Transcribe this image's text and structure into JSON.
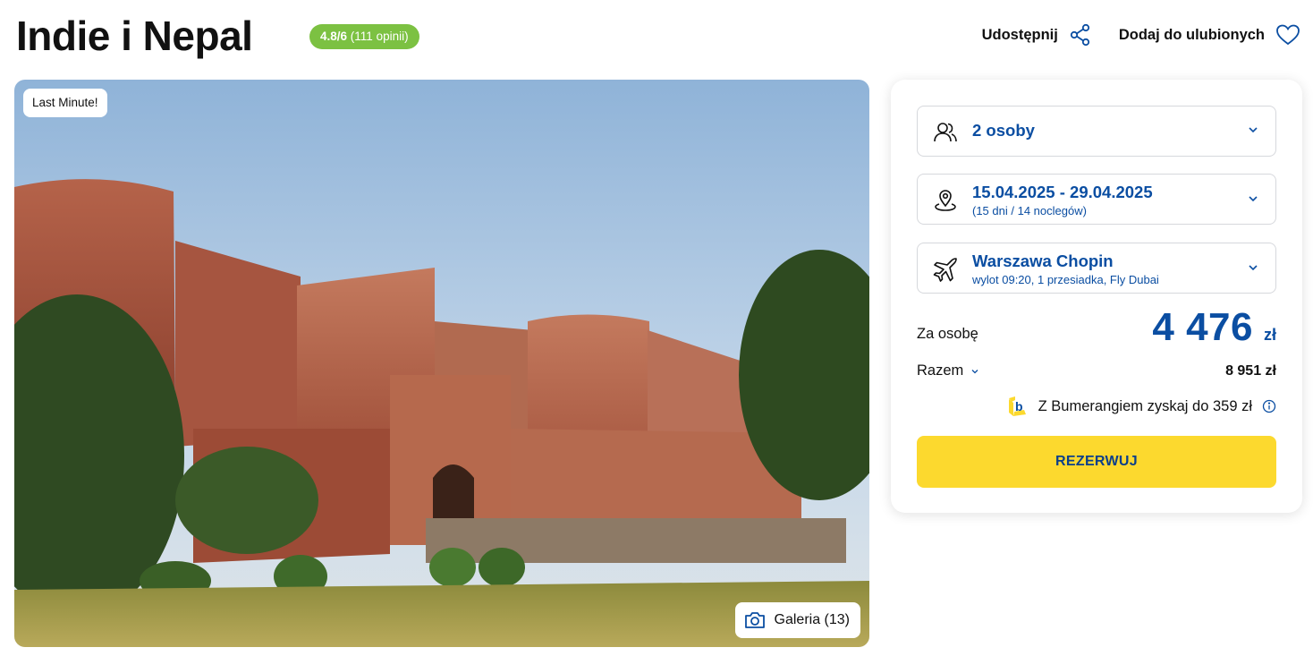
{
  "header": {
    "title": "Indie i Nepal",
    "rating_score": "4.8/6",
    "rating_count": "(111 opinii)",
    "share_label": "Udostępnij",
    "favorite_label": "Dodaj do ulubionych"
  },
  "hero": {
    "badge": "Last Minute!",
    "gallery_label": "Galeria (13)"
  },
  "booking": {
    "travelers": "2 osoby",
    "dates": "15.04.2025 - 29.04.2025",
    "dates_sub": "(15 dni / 14 noclegów)",
    "departure": "Warszawa Chopin",
    "departure_sub": "wylot 09:20, 1 przesiadka, Fly Dubai",
    "per_person_label": "Za osobę",
    "per_person_price": "4 476",
    "currency": "zł",
    "total_label": "Razem",
    "total_price": "8 951 zł",
    "bonus_text": "Z Bumerangiem zyskaj do 359 zł",
    "book_button": "REZERWUJ"
  },
  "colors": {
    "brand_blue": "#0b4ea2",
    "rating_green": "#7cc142",
    "cta_yellow": "#fcd92e"
  }
}
